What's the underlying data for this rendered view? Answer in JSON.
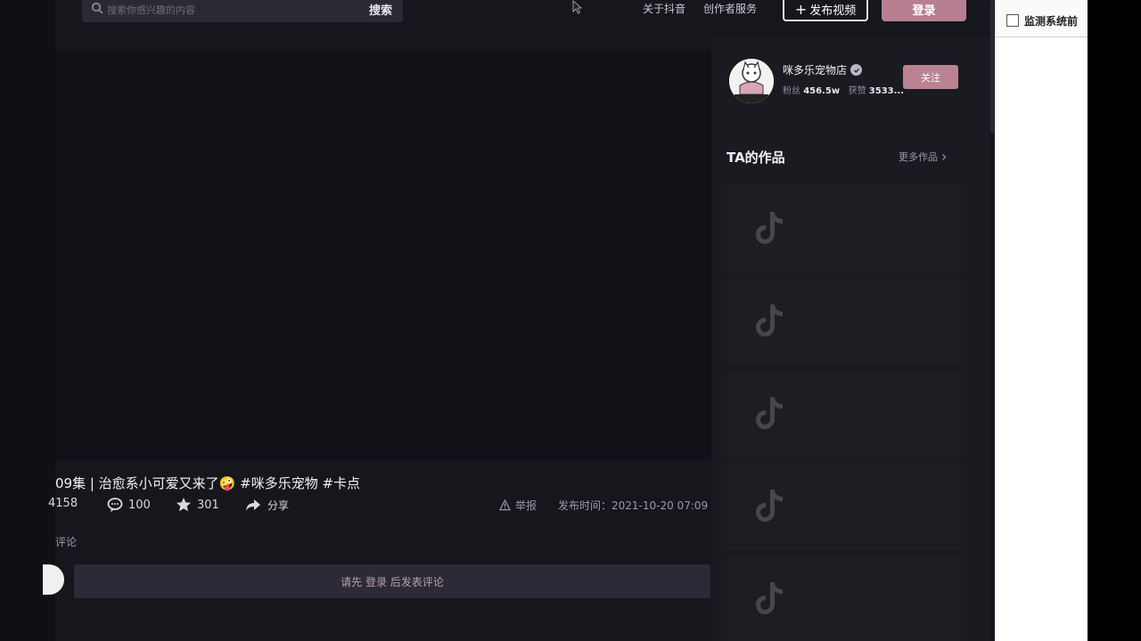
{
  "header": {
    "search_placeholder": "搜索你感兴趣的内容",
    "search_button": "搜索",
    "nav_about": "关于抖音",
    "nav_creator": "创作者服务",
    "publish_plus": "+",
    "publish_label": "发布视频",
    "login_label": "登录"
  },
  "video": {
    "title": "09集 | 治愈系小可爱又来了🤪 #咪多乐宠物 #卡点",
    "likes": "4158",
    "comments": "100",
    "favorites": "301",
    "share_label": "分享",
    "report_label": "举报",
    "publish_time": "发布时间：2021-10-20 07:09",
    "comments_label": "评论",
    "comment_prompt": "请先 登录 后发表评论"
  },
  "author": {
    "name": "咪多乐宠物店",
    "fans_label": "粉丝",
    "fans_value": "456.5w",
    "likes_label": "获赞",
    "likes_value": "3533...",
    "follow_label": "关注"
  },
  "works": {
    "title": "TA的作品",
    "more_label": "更多作品"
  },
  "side_panel": {
    "checkbox_label": "监测系统前"
  },
  "colors": {
    "background": "#16161d",
    "accent": "#b77f92",
    "comment_box": "#2b2a36"
  },
  "icons": [
    "search-icon",
    "cursor-icon",
    "heart-icon",
    "comment-icon",
    "star-icon",
    "share-icon",
    "warning-icon",
    "verify-icon",
    "chevron-right-icon",
    "tiktok-icon"
  ]
}
